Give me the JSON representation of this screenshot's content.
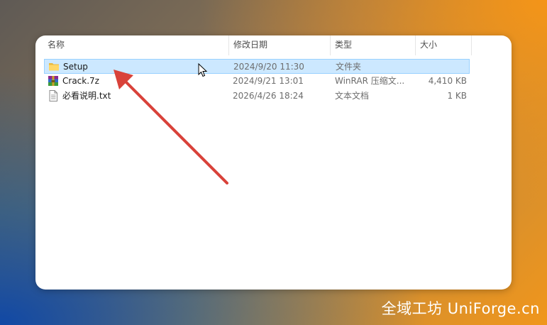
{
  "columns": {
    "name": "名称",
    "date": "修改日期",
    "type": "类型",
    "size": "大小"
  },
  "files": [
    {
      "name": "Setup",
      "date": "2024/9/20 11:30",
      "type": "文件夹",
      "size": "",
      "icon": "folder-icon",
      "selected": true
    },
    {
      "name": "Crack.7z",
      "date": "2024/9/21 13:01",
      "type": "WinRAR 压缩文...",
      "size": "4,410 KB",
      "icon": "winrar-archive-icon",
      "selected": false
    },
    {
      "name": "必看说明.txt",
      "date": "2026/4/26 18:24",
      "type": "文本文档",
      "size": "1 KB",
      "icon": "text-file-icon",
      "selected": false
    }
  ],
  "watermark": "全域工坊 UniForge.cn",
  "colors": {
    "selection": "#cce8ff",
    "selection_border": "#99d1ff",
    "arrow": "#d9423a",
    "accent_bg": "#f0961c"
  }
}
